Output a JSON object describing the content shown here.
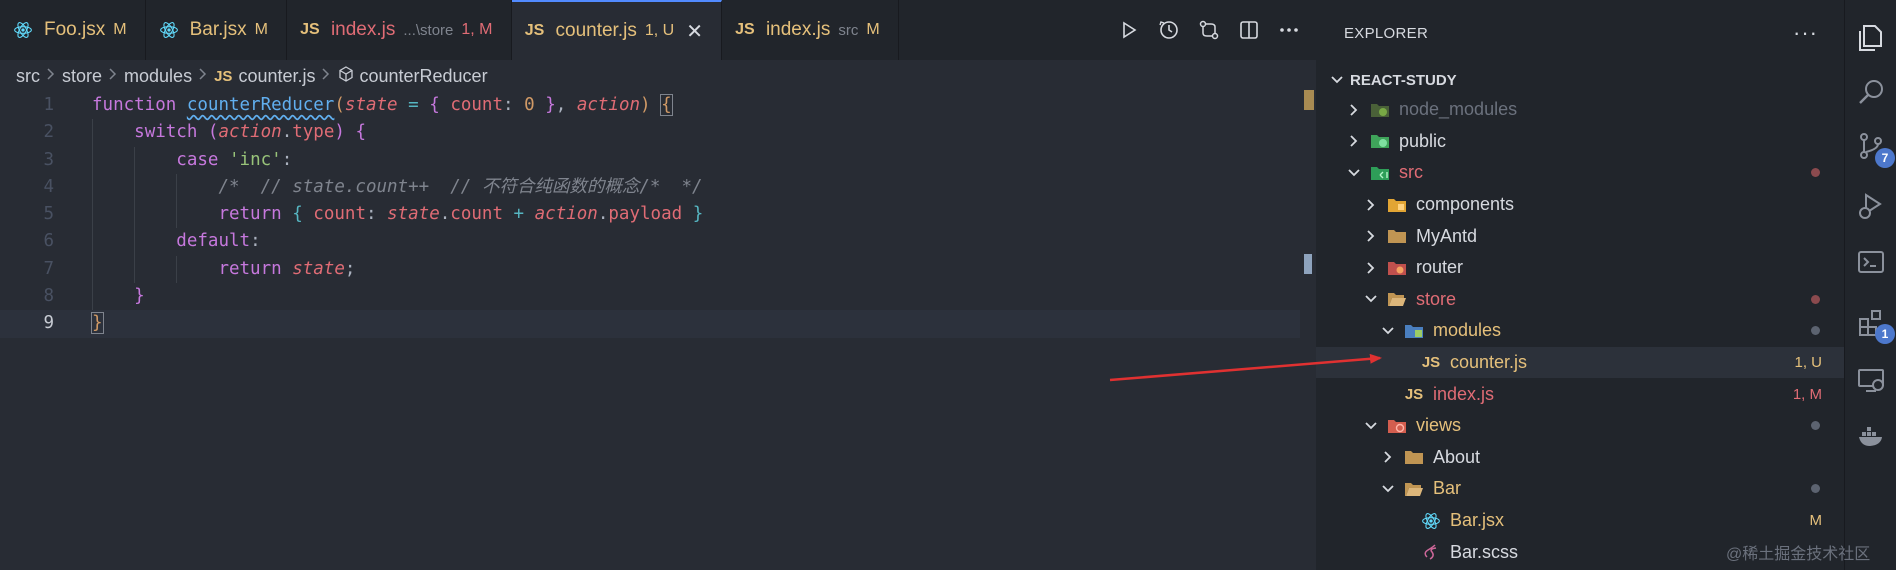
{
  "tabs": [
    {
      "name": "Foo.jsx",
      "desc": "",
      "flag": "M",
      "icon": "react-icon",
      "name_style": "mod",
      "flag_style": "mod",
      "active": false
    },
    {
      "name": "Bar.jsx",
      "desc": "",
      "flag": "M",
      "icon": "react-icon",
      "name_style": "mod",
      "flag_style": "mod",
      "active": false
    },
    {
      "name": "index.js",
      "desc": "...\\store",
      "flag": "1, M",
      "icon": "js-icon",
      "name_style": "err",
      "flag_style": "err",
      "active": false
    },
    {
      "name": "counter.js",
      "desc": "",
      "flag": "1, U",
      "icon": "js-icon",
      "name_style": "untracked",
      "flag_style": "mod",
      "active": true
    },
    {
      "name": "index.js",
      "desc": "src",
      "flag": "M",
      "icon": "js-icon",
      "name_style": "mod",
      "flag_style": "mod",
      "active": false
    }
  ],
  "js_icon_text": "JS",
  "close_glyph": "✕",
  "tab_actions": [
    "run-icon",
    "timeline-icon",
    "compare-changes-icon",
    "split-editor-icon",
    "more-actions-icon"
  ],
  "breadcrumb": {
    "parts": [
      "src",
      "store",
      "modules"
    ],
    "file": "counter.js",
    "symbol": "counterReducer"
  },
  "code": {
    "line_numbers": [
      "1",
      "2",
      "3",
      "4",
      "5",
      "6",
      "7",
      "8",
      "9"
    ],
    "current_line": 9,
    "lines": [
      [
        [
          "kw",
          "function"
        ],
        [
          "pu",
          " "
        ],
        [
          "fn",
          "counterReducer"
        ],
        [
          "br1",
          "("
        ],
        [
          "pa",
          "state"
        ],
        [
          "pu",
          " "
        ],
        [
          "op",
          "="
        ],
        [
          "pu",
          " "
        ],
        [
          "br2",
          "{"
        ],
        [
          "pu",
          " "
        ],
        [
          "pr",
          "count"
        ],
        [
          "pu",
          ": "
        ],
        [
          "nu",
          "0"
        ],
        [
          "pu",
          " "
        ],
        [
          "br2",
          "}"
        ],
        [
          "pu",
          ", "
        ],
        [
          "pa",
          "action"
        ],
        [
          "br1",
          ")"
        ],
        [
          "pu",
          " "
        ],
        [
          "br1 brm",
          "{"
        ]
      ],
      [
        [
          "pu",
          "    "
        ],
        [
          "kw",
          "switch"
        ],
        [
          "pu",
          " "
        ],
        [
          "br2",
          "("
        ],
        [
          "pa",
          "action"
        ],
        [
          "pu",
          "."
        ],
        [
          "pr",
          "type"
        ],
        [
          "br2",
          ")"
        ],
        [
          "pu",
          " "
        ],
        [
          "br2",
          "{"
        ]
      ],
      [
        [
          "pu",
          "        "
        ],
        [
          "kw",
          "case"
        ],
        [
          "pu",
          " "
        ],
        [
          "st",
          "'inc'"
        ],
        [
          "pu",
          ":"
        ]
      ],
      [
        [
          "pu",
          "            "
        ],
        [
          "cm",
          "/*  // state.count++  // 不符合纯函数的概念/*  */"
        ]
      ],
      [
        [
          "pu",
          "            "
        ],
        [
          "kw",
          "return"
        ],
        [
          "pu",
          " "
        ],
        [
          "op",
          "{"
        ],
        [
          "pu",
          " "
        ],
        [
          "pr",
          "count"
        ],
        [
          "pu",
          ": "
        ],
        [
          "pa",
          "state"
        ],
        [
          "pu",
          "."
        ],
        [
          "pr",
          "count"
        ],
        [
          "pu",
          " "
        ],
        [
          "op",
          "+"
        ],
        [
          "pu",
          " "
        ],
        [
          "pa",
          "action"
        ],
        [
          "pu",
          "."
        ],
        [
          "pr",
          "payload"
        ],
        [
          "pu",
          " "
        ],
        [
          "op",
          "}"
        ]
      ],
      [
        [
          "pu",
          "        "
        ],
        [
          "kw",
          "default"
        ],
        [
          "pu",
          ":"
        ]
      ],
      [
        [
          "pu",
          "            "
        ],
        [
          "kw",
          "return"
        ],
        [
          "pu",
          " "
        ],
        [
          "pa",
          "state"
        ],
        [
          "pu",
          ";"
        ]
      ],
      [
        [
          "pu",
          "    "
        ],
        [
          "br2",
          "}"
        ]
      ],
      [
        [
          "br1 brm",
          "}"
        ]
      ]
    ]
  },
  "explorer": {
    "title": "EXPLORER",
    "more": "···",
    "workspace": "REACT-STUDY",
    "tree": [
      {
        "label": "node_modules",
        "depth": 1,
        "chevron": "right",
        "icon": "node-modules-folder-icon",
        "style": "dim",
        "badge": "",
        "dot": ""
      },
      {
        "label": "public",
        "depth": 1,
        "chevron": "right",
        "icon": "public-folder-icon",
        "style": "",
        "badge": "",
        "dot": ""
      },
      {
        "label": "src",
        "depth": 1,
        "chevron": "down",
        "icon": "src-folder-icon",
        "style": "err",
        "badge": "",
        "dot": "red"
      },
      {
        "label": "components",
        "depth": 2,
        "chevron": "right",
        "icon": "components-folder-icon",
        "style": "",
        "badge": "",
        "dot": ""
      },
      {
        "label": "MyAntd",
        "depth": 2,
        "chevron": "right",
        "icon": "folder-icon",
        "style": "",
        "badge": "",
        "dot": ""
      },
      {
        "label": "router",
        "depth": 2,
        "chevron": "right",
        "icon": "router-folder-icon",
        "style": "",
        "badge": "",
        "dot": ""
      },
      {
        "label": "store",
        "depth": 2,
        "chevron": "down",
        "icon": "store-folder-icon",
        "style": "err",
        "badge": "",
        "dot": "red"
      },
      {
        "label": "modules",
        "depth": 3,
        "chevron": "down",
        "icon": "modules-folder-icon",
        "style": "mod",
        "badge": "",
        "dot": "gray"
      },
      {
        "label": "counter.js",
        "depth": 4,
        "chevron": "none",
        "icon": "js-file-icon",
        "style": "untr",
        "badge": "1, U",
        "badge_style": "mod",
        "dot": "",
        "selected": true
      },
      {
        "label": "index.js",
        "depth": 3,
        "chevron": "none",
        "icon": "js-file-icon",
        "style": "err",
        "badge": "1, M",
        "badge_style": "err",
        "dot": ""
      },
      {
        "label": "views",
        "depth": 2,
        "chevron": "down",
        "icon": "views-folder-icon",
        "style": "mod",
        "badge": "",
        "dot": "gray"
      },
      {
        "label": "About",
        "depth": 3,
        "chevron": "right",
        "icon": "folder-icon",
        "style": "",
        "badge": "",
        "dot": ""
      },
      {
        "label": "Bar",
        "depth": 3,
        "chevron": "down",
        "icon": "folder-open-icon",
        "style": "mod",
        "badge": "",
        "dot": "gray"
      },
      {
        "label": "Bar.jsx",
        "depth": 4,
        "chevron": "none",
        "icon": "react-icon",
        "style": "mod",
        "badge": "M",
        "badge_style": "mod",
        "dot": ""
      },
      {
        "label": "Bar.scss",
        "depth": 4,
        "chevron": "none",
        "icon": "sass-icon",
        "style": "",
        "badge": "",
        "dot": ""
      }
    ]
  },
  "activity_bar": [
    {
      "icon": "files-icon",
      "badge": ""
    },
    {
      "icon": "search-icon",
      "badge": ""
    },
    {
      "icon": "source-control-icon",
      "badge": "7"
    },
    {
      "icon": "run-debug-icon",
      "badge": ""
    },
    {
      "icon": "terminal-icon",
      "badge": ""
    },
    {
      "icon": "extensions-icon",
      "badge": "1"
    },
    {
      "icon": "remote-explorer-icon",
      "badge": ""
    },
    {
      "icon": "docker-icon",
      "badge": ""
    }
  ],
  "watermark": "@稀土掘金技术社区",
  "colors": {
    "accent": "#528bff",
    "modified": "#e5c07b",
    "error": "#e06c75",
    "background": "#282c34",
    "sidebar": "#21252b"
  }
}
